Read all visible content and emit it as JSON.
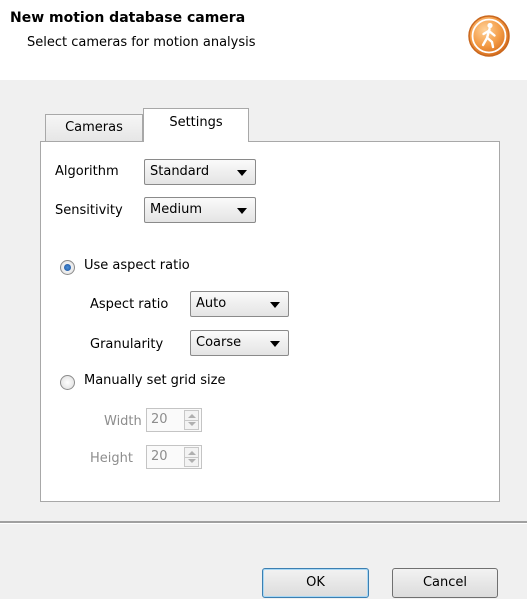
{
  "header": {
    "title": "New motion database camera",
    "subtitle": "Select cameras for motion analysis",
    "icon": "walking-person-icon",
    "icon_color": "#f39b45"
  },
  "tabs": [
    {
      "label": "Cameras",
      "active": false
    },
    {
      "label": "Settings",
      "active": true
    }
  ],
  "settings": {
    "algorithm_label": "Algorithm",
    "algorithm_value": "Standard",
    "sensitivity_label": "Sensitivity",
    "sensitivity_value": "Medium",
    "use_aspect_ratio_label": "Use aspect ratio",
    "use_aspect_ratio_checked": true,
    "aspect_ratio_label": "Aspect ratio",
    "aspect_ratio_value": "Auto",
    "granularity_label": "Granularity",
    "granularity_value": "Coarse",
    "manual_grid_label": "Manually set grid size",
    "manual_grid_checked": false,
    "width_label": "Width",
    "width_value": "20",
    "height_label": "Height",
    "height_value": "20"
  },
  "footer": {
    "ok_label": "OK",
    "cancel_label": "Cancel"
  }
}
